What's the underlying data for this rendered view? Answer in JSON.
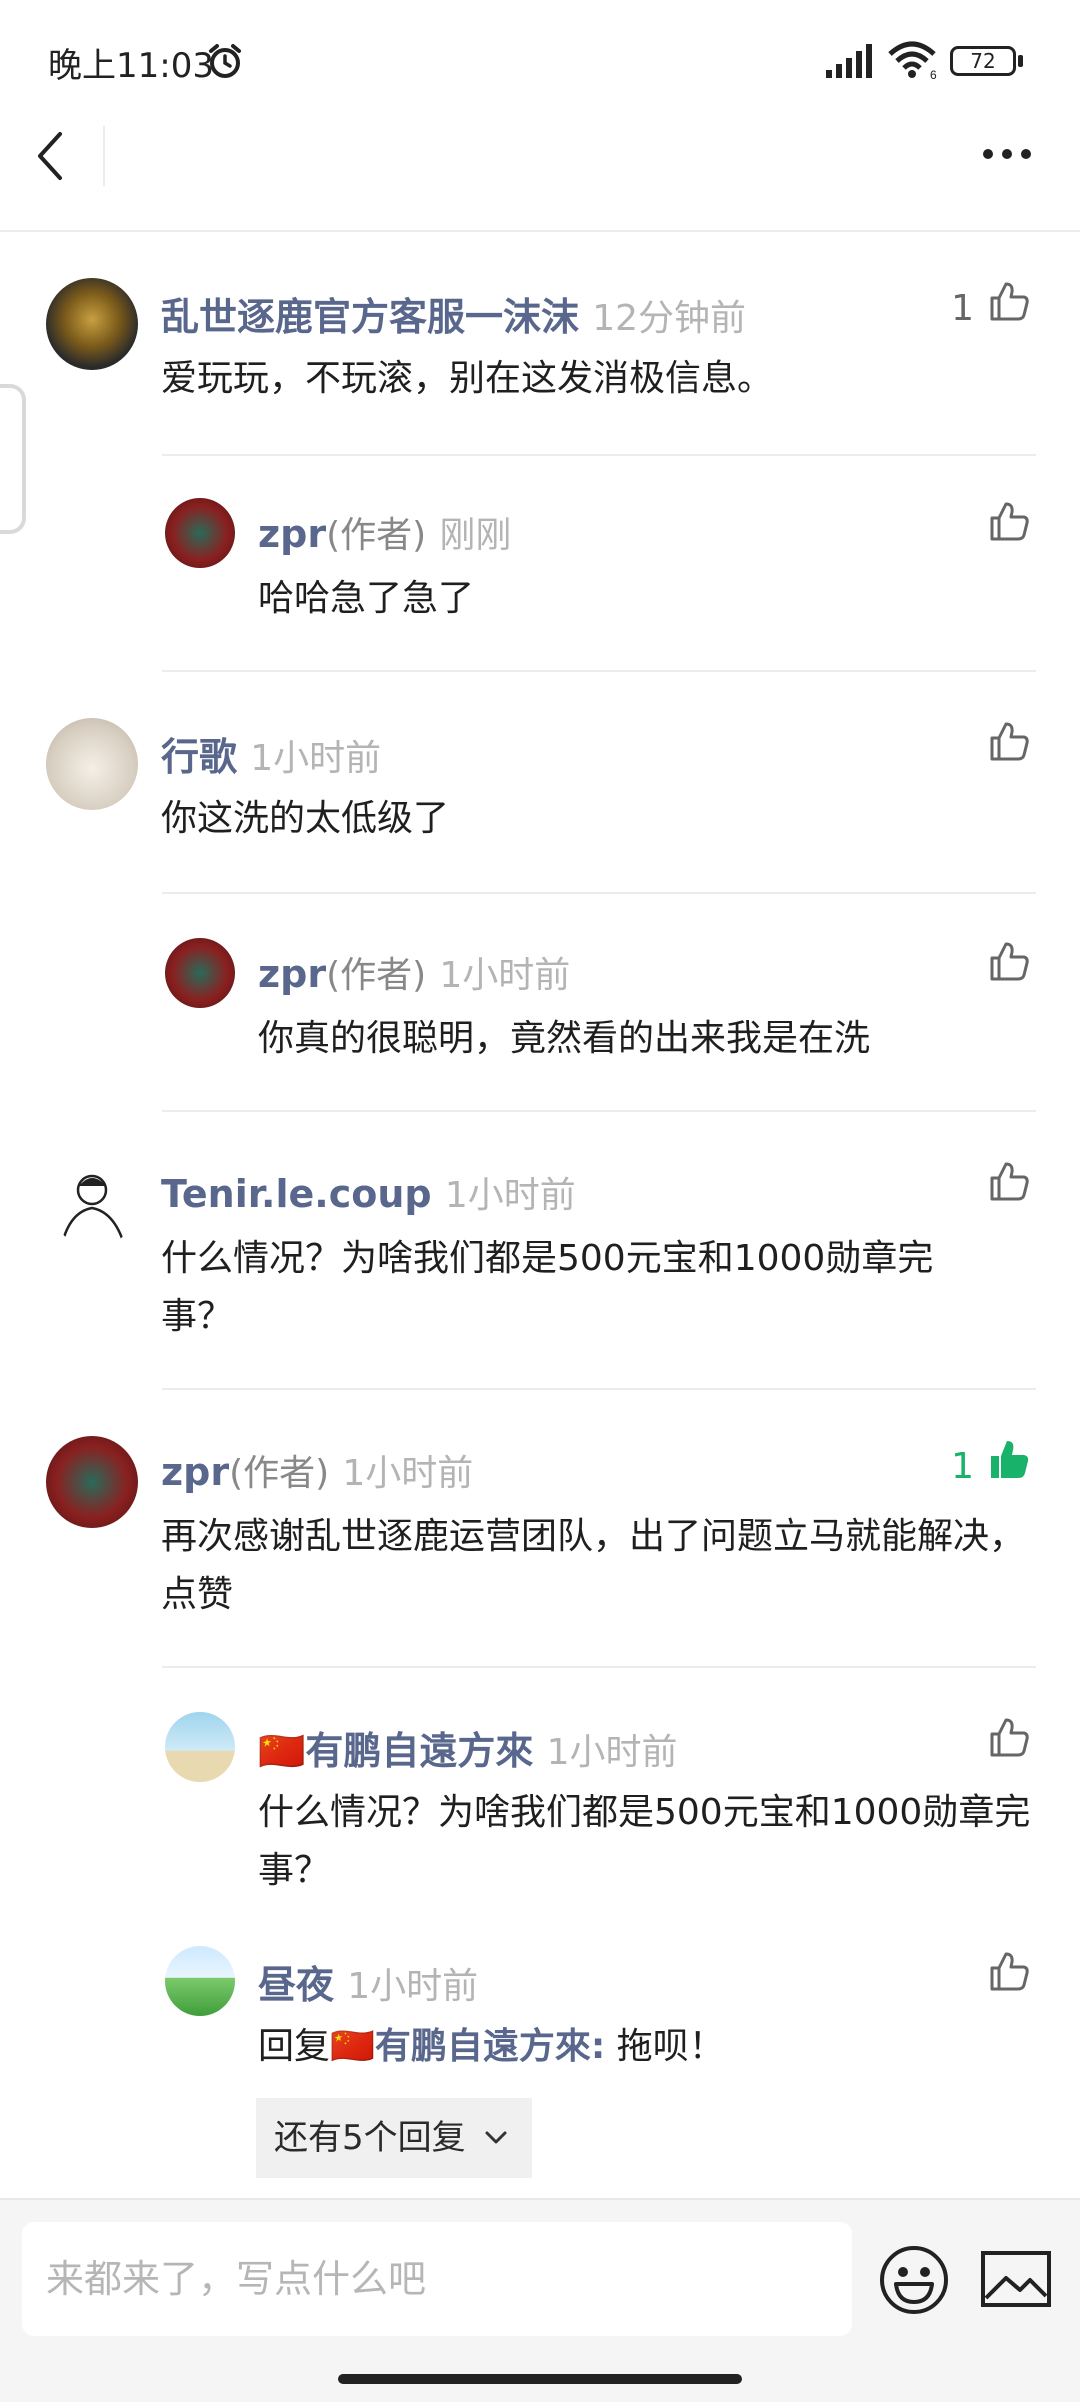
{
  "status": {
    "time": "晚上11:03",
    "battery": "72"
  },
  "comments": [
    {
      "name": "乱世逐鹿官方客服一沫沫",
      "time": "12分钟前",
      "text": "爱玩玩，不玩滚，别在这发消极信息。",
      "likes": "1"
    },
    {
      "name": "zpr",
      "role": "(作者)",
      "time": "刚刚",
      "text": "哈哈急了急了"
    },
    {
      "name": "行歌",
      "time": "1小时前",
      "text": "你这洗的太低级了"
    },
    {
      "name": "zpr",
      "role": "(作者)",
      "time": "1小时前",
      "text": "你真的很聪明，竟然看的出来我是在洗"
    },
    {
      "name": "Tenir.le.coup",
      "time": "1小时前",
      "text": "什么情况？为啥我们都是500元宝和1000勋章完事？"
    },
    {
      "name": "zpr",
      "role": "(作者)",
      "time": "1小时前",
      "text": "再次感谢乱世逐鹿运营团队，出了问题立马就能解决，点赞",
      "likes": "1"
    },
    {
      "name": "🇨🇳有鹏自遠方來",
      "time": "1小时前",
      "text": "什么情况？为啥我们都是500元宝和1000勋章完事？"
    },
    {
      "name": "昼夜",
      "time": "1小时前",
      "reply_prefix": "回复",
      "reply_to": "🇨🇳有鹏自遠方來:",
      "reply_text": " 拖呗！"
    }
  ],
  "more_replies": "还有5个回复",
  "input": {
    "placeholder": "来都来了，写点什么吧"
  },
  "colors": {
    "name": "#59678d",
    "time": "#b4b4b4",
    "liked": "#19b26a"
  },
  "icons": [
    "back-icon",
    "more-icon",
    "thumbs-up-icon",
    "emoji-icon",
    "image-icon",
    "alarm-icon",
    "signal-icon",
    "wifi-icon",
    "battery-icon"
  ]
}
